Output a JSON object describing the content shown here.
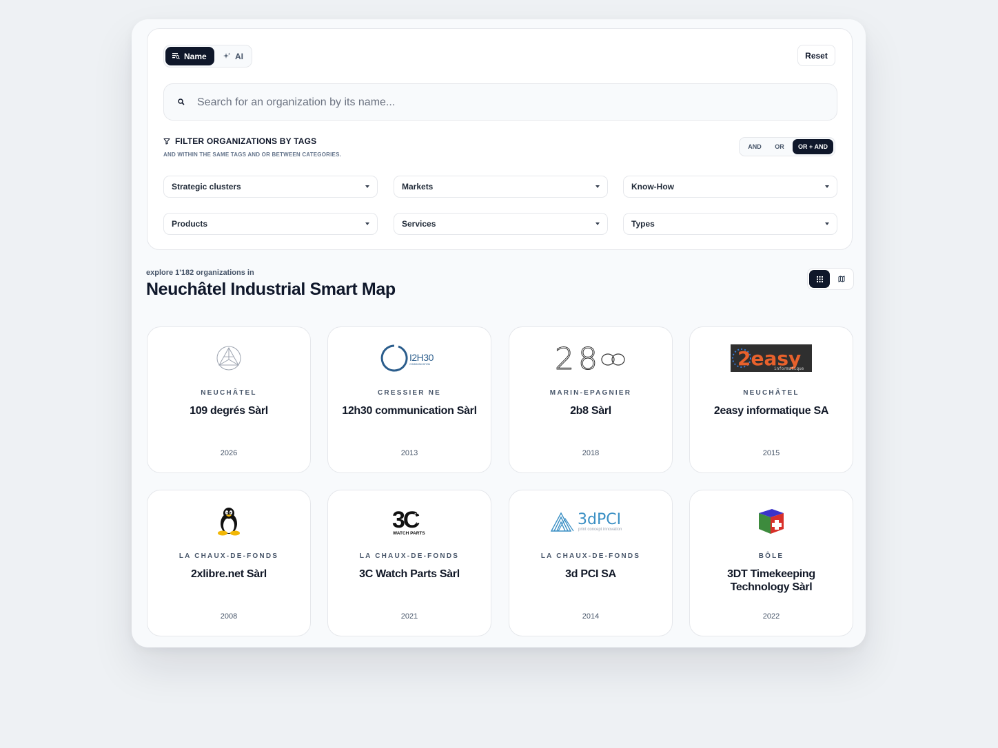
{
  "mode_toggle": {
    "name_label": "Name",
    "ai_label": "AI"
  },
  "reset_label": "Reset",
  "search": {
    "placeholder": "Search for an organization by its name...",
    "value": ""
  },
  "filter": {
    "title": "FILTER ORGANIZATIONS BY TAGS",
    "subtitle": "AND WITHIN THE SAME TAGS AND OR BETWEEN CATEGORIES.",
    "logic_options": [
      "AND",
      "OR",
      "OR + AND"
    ],
    "logic_selected": "OR + AND",
    "dropdowns": [
      "Strategic clusters",
      "Markets",
      "Know-How",
      "Products",
      "Services",
      "Types"
    ]
  },
  "explore_label": "explore 1'182 organizations in",
  "page_title": "Neuchâtel Industrial Smart Map",
  "view_toggle": {
    "selected": "grid"
  },
  "organizations": [
    {
      "city": "NEUCHÂTEL",
      "name": "109 degrés Sàrl",
      "year": "2026",
      "logo": "triangle-circle-logo"
    },
    {
      "city": "CRESSIER NE",
      "name": "12h30 communication Sàrl",
      "year": "2013",
      "logo": "12h30-logo",
      "logo_text": "I2H30",
      "logo_subtext": "COMMUNICATION"
    },
    {
      "city": "MARIN-EPAGNIER",
      "name": "2b8 Sàrl",
      "year": "2018",
      "logo": "2b8-logo",
      "logo_text": "28"
    },
    {
      "city": "NEUCHÂTEL",
      "name": "2easy informatique SA",
      "year": "2015",
      "logo": "2easy-logo",
      "logo_text": "2easy",
      "logo_subtext": "informatique"
    },
    {
      "city": "LA CHAUX-DE-FONDS",
      "name": "2xlibre.net Sàrl",
      "year": "2008",
      "logo": "tux-penguin-logo"
    },
    {
      "city": "LA CHAUX-DE-FONDS",
      "name": "3C Watch Parts Sàrl",
      "year": "2021",
      "logo": "3c-watch-parts-logo",
      "logo_text": "3C",
      "logo_subtext": "WATCH PARTS"
    },
    {
      "city": "LA CHAUX-DE-FONDS",
      "name": "3d PCI SA",
      "year": "2014",
      "logo": "3dpci-logo",
      "logo_text": "3dPCI",
      "logo_subtext": "print concept innovation"
    },
    {
      "city": "BÔLE",
      "name": "3DT Timekeeping Technology Sàrl",
      "year": "2022",
      "logo": "swiss-cube-logo"
    }
  ],
  "colors": {
    "dark": "#0f172a",
    "background": "#eef1f4",
    "card_border": "#e5e7eb",
    "logo_blue": "#2b5d8c",
    "logo_teal": "#3a8fc4"
  }
}
